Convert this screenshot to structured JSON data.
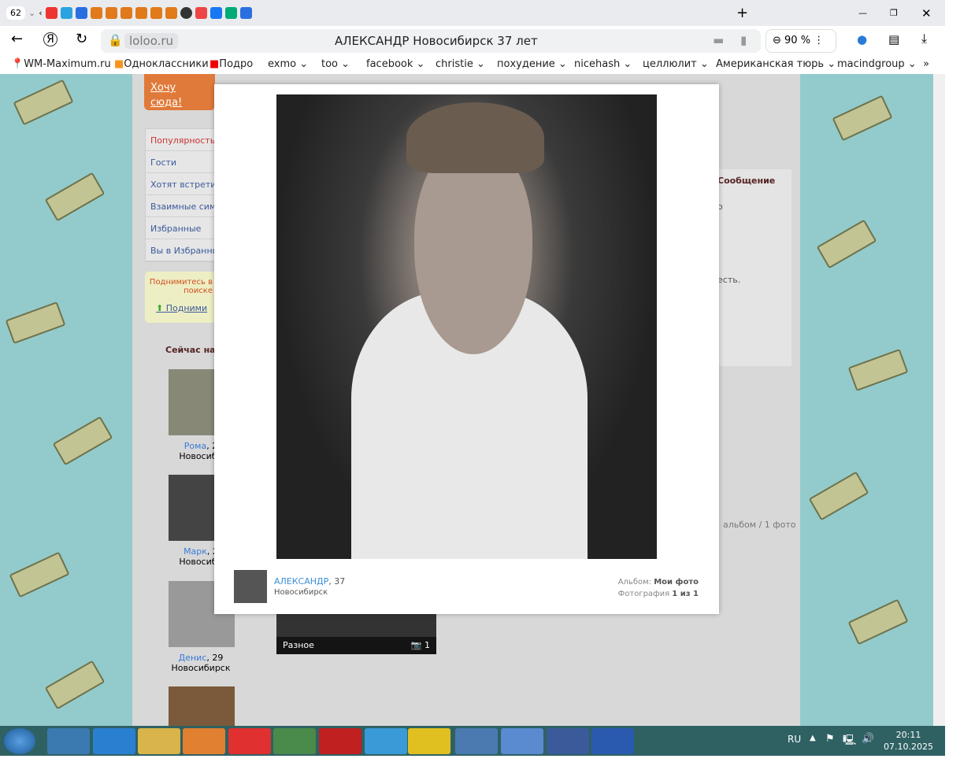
{
  "browser": {
    "tab_count": "62",
    "url_domain": "loloo.ru",
    "page_title": "АЛЕКСАНДР Новосибирск 37 лет",
    "zoom": "90 %",
    "bookmarks": [
      "WM-Maximum.ru",
      "Одноклассники",
      "Подро",
      "exmo",
      "too",
      "facebook",
      "christie",
      "похудение",
      "nicehash",
      "целлюлит",
      "Американская тюрь",
      "macindgroup"
    ]
  },
  "sidebar": {
    "cta": "Хочу сюда!",
    "menu": [
      "Популярность",
      "Гости",
      "Хотят встретит",
      "Взаимные симп",
      "Избранные",
      "Вы в Избранны"
    ],
    "promo_text": "Поднимитесь в поиске",
    "promo_link": "Подними",
    "now_online": "Сейчас на",
    "users": [
      {
        "name": "Рома",
        "rest": ", 2",
        "city": "Новосиби"
      },
      {
        "name": "Марк",
        "rest": ", 2",
        "city": "Новосиби"
      },
      {
        "name": "Денис",
        "rest": ", 29",
        "city": "Новосибирск"
      }
    ]
  },
  "right": {
    "message": "Сообщение",
    "text1": "о",
    "text2": "есть.",
    "album_info": "альбом / 1 фото"
  },
  "album": {
    "name": "Разное",
    "count": "1"
  },
  "modal": {
    "user_name": "АЛЕКСАНДР",
    "user_age": ", 37",
    "user_city": "Новосибирск",
    "album_label": "Альбом: ",
    "album_name": "Мои фото",
    "photo_label": "Фотография ",
    "photo_index": "1 из 1"
  },
  "taskbar": {
    "lang": "RU",
    "time": "20:11",
    "date": "07.10.2025"
  }
}
